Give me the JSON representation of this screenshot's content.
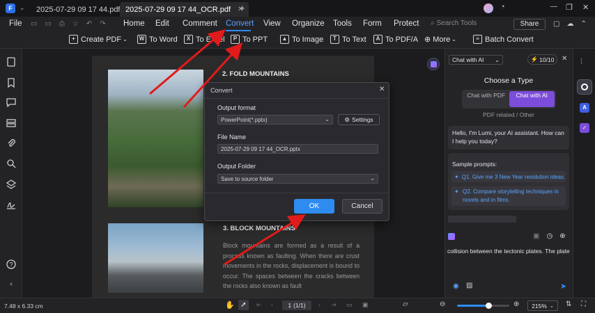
{
  "tabs": [
    {
      "label": "2025-07-29 09 17 44.pdf"
    },
    {
      "label": "2025-07-29 09 17 44_OCR.pdf"
    }
  ],
  "window": {
    "avatar_initial": "",
    "minimize": "—",
    "restore": "❐",
    "close": "✕"
  },
  "menu": {
    "file": "File",
    "items": [
      "Home",
      "Edit",
      "Comment",
      "Convert",
      "View",
      "Organize",
      "Tools",
      "Form",
      "Protect"
    ],
    "search_placeholder": "Search Tools",
    "share": "Share"
  },
  "toolbar": {
    "create_pdf": "Create PDF",
    "to_word": "To Word",
    "to_excel": "To Excel",
    "to_ppt": "To PPT",
    "to_image": "To Image",
    "to_text": "To Text",
    "to_pdfa": "To PDF/A",
    "more": "More",
    "batch": "Batch Convert"
  },
  "doc": {
    "heading1": "2. FOLD MOUNTAINS",
    "heading2": "3. BLOCK MOUNTAINS",
    "para2": "Block mountains are formed as a result of a process known as faulting. When there are crust movements in the rocks, displacement is bound to occur. The spaces between the cracks between the rocks also known as fault"
  },
  "dialog": {
    "title": "Convert",
    "output_format_label": "Output format",
    "output_format_value": "PowerPoint(*.pptx)",
    "settings": "Settings",
    "file_name_label": "File Name",
    "file_name_value": "2025-07-29 09 17 44_OCR.pptx",
    "output_folder_label": "Output Folder",
    "output_folder_value": "Save to source folder",
    "ok": "OK",
    "cancel": "Cancel"
  },
  "ai": {
    "mode_select": "Chat with AI",
    "credits": "10/10",
    "choose_type": "Choose a Type",
    "chat_pdf": "Chat with PDF",
    "chat_ai": "Chat with AI",
    "related": "PDF related / Other",
    "greeting": "Hello, I'm Lumi, your AI assistant. How can I help you today?",
    "sample_title": "Sample prompts:",
    "prompts": [
      "Q1. Give me 3 New Year resolution ideas.",
      "Q2. Compare storytelling techniques in novels and in films."
    ],
    "input_text": "collision between the tectonic plates. The plate"
  },
  "status": {
    "dimensions": "7.48 x 6.33 cm",
    "page": "1",
    "page_of": "(1/1)",
    "zoom": "215%",
    "zoom_fill": 0.6
  },
  "colors": {
    "accent": "#2e8cf0",
    "highlight": "#e11b1b",
    "arrow": "#e11b1b",
    "ai_purple": "#7c4ddb"
  }
}
